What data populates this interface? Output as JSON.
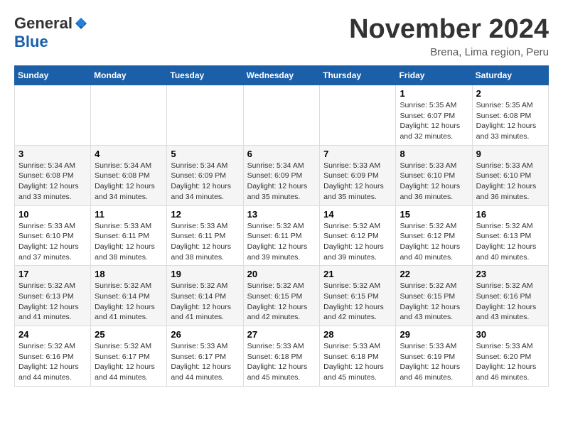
{
  "header": {
    "logo_general": "General",
    "logo_blue": "Blue",
    "month_title": "November 2024",
    "location": "Brena, Lima region, Peru"
  },
  "calendar": {
    "headers": [
      "Sunday",
      "Monday",
      "Tuesday",
      "Wednesday",
      "Thursday",
      "Friday",
      "Saturday"
    ],
    "weeks": [
      [
        {
          "day": "",
          "info": ""
        },
        {
          "day": "",
          "info": ""
        },
        {
          "day": "",
          "info": ""
        },
        {
          "day": "",
          "info": ""
        },
        {
          "day": "",
          "info": ""
        },
        {
          "day": "1",
          "info": "Sunrise: 5:35 AM\nSunset: 6:07 PM\nDaylight: 12 hours and 32 minutes."
        },
        {
          "day": "2",
          "info": "Sunrise: 5:35 AM\nSunset: 6:08 PM\nDaylight: 12 hours and 33 minutes."
        }
      ],
      [
        {
          "day": "3",
          "info": "Sunrise: 5:34 AM\nSunset: 6:08 PM\nDaylight: 12 hours and 33 minutes."
        },
        {
          "day": "4",
          "info": "Sunrise: 5:34 AM\nSunset: 6:08 PM\nDaylight: 12 hours and 34 minutes."
        },
        {
          "day": "5",
          "info": "Sunrise: 5:34 AM\nSunset: 6:09 PM\nDaylight: 12 hours and 34 minutes."
        },
        {
          "day": "6",
          "info": "Sunrise: 5:34 AM\nSunset: 6:09 PM\nDaylight: 12 hours and 35 minutes."
        },
        {
          "day": "7",
          "info": "Sunrise: 5:33 AM\nSunset: 6:09 PM\nDaylight: 12 hours and 35 minutes."
        },
        {
          "day": "8",
          "info": "Sunrise: 5:33 AM\nSunset: 6:10 PM\nDaylight: 12 hours and 36 minutes."
        },
        {
          "day": "9",
          "info": "Sunrise: 5:33 AM\nSunset: 6:10 PM\nDaylight: 12 hours and 36 minutes."
        }
      ],
      [
        {
          "day": "10",
          "info": "Sunrise: 5:33 AM\nSunset: 6:10 PM\nDaylight: 12 hours and 37 minutes."
        },
        {
          "day": "11",
          "info": "Sunrise: 5:33 AM\nSunset: 6:11 PM\nDaylight: 12 hours and 38 minutes."
        },
        {
          "day": "12",
          "info": "Sunrise: 5:33 AM\nSunset: 6:11 PM\nDaylight: 12 hours and 38 minutes."
        },
        {
          "day": "13",
          "info": "Sunrise: 5:32 AM\nSunset: 6:11 PM\nDaylight: 12 hours and 39 minutes."
        },
        {
          "day": "14",
          "info": "Sunrise: 5:32 AM\nSunset: 6:12 PM\nDaylight: 12 hours and 39 minutes."
        },
        {
          "day": "15",
          "info": "Sunrise: 5:32 AM\nSunset: 6:12 PM\nDaylight: 12 hours and 40 minutes."
        },
        {
          "day": "16",
          "info": "Sunrise: 5:32 AM\nSunset: 6:13 PM\nDaylight: 12 hours and 40 minutes."
        }
      ],
      [
        {
          "day": "17",
          "info": "Sunrise: 5:32 AM\nSunset: 6:13 PM\nDaylight: 12 hours and 41 minutes."
        },
        {
          "day": "18",
          "info": "Sunrise: 5:32 AM\nSunset: 6:14 PM\nDaylight: 12 hours and 41 minutes."
        },
        {
          "day": "19",
          "info": "Sunrise: 5:32 AM\nSunset: 6:14 PM\nDaylight: 12 hours and 41 minutes."
        },
        {
          "day": "20",
          "info": "Sunrise: 5:32 AM\nSunset: 6:15 PM\nDaylight: 12 hours and 42 minutes."
        },
        {
          "day": "21",
          "info": "Sunrise: 5:32 AM\nSunset: 6:15 PM\nDaylight: 12 hours and 42 minutes."
        },
        {
          "day": "22",
          "info": "Sunrise: 5:32 AM\nSunset: 6:15 PM\nDaylight: 12 hours and 43 minutes."
        },
        {
          "day": "23",
          "info": "Sunrise: 5:32 AM\nSunset: 6:16 PM\nDaylight: 12 hours and 43 minutes."
        }
      ],
      [
        {
          "day": "24",
          "info": "Sunrise: 5:32 AM\nSunset: 6:16 PM\nDaylight: 12 hours and 44 minutes."
        },
        {
          "day": "25",
          "info": "Sunrise: 5:32 AM\nSunset: 6:17 PM\nDaylight: 12 hours and 44 minutes."
        },
        {
          "day": "26",
          "info": "Sunrise: 5:33 AM\nSunset: 6:17 PM\nDaylight: 12 hours and 44 minutes."
        },
        {
          "day": "27",
          "info": "Sunrise: 5:33 AM\nSunset: 6:18 PM\nDaylight: 12 hours and 45 minutes."
        },
        {
          "day": "28",
          "info": "Sunrise: 5:33 AM\nSunset: 6:18 PM\nDaylight: 12 hours and 45 minutes."
        },
        {
          "day": "29",
          "info": "Sunrise: 5:33 AM\nSunset: 6:19 PM\nDaylight: 12 hours and 46 minutes."
        },
        {
          "day": "30",
          "info": "Sunrise: 5:33 AM\nSunset: 6:20 PM\nDaylight: 12 hours and 46 minutes."
        }
      ]
    ]
  }
}
